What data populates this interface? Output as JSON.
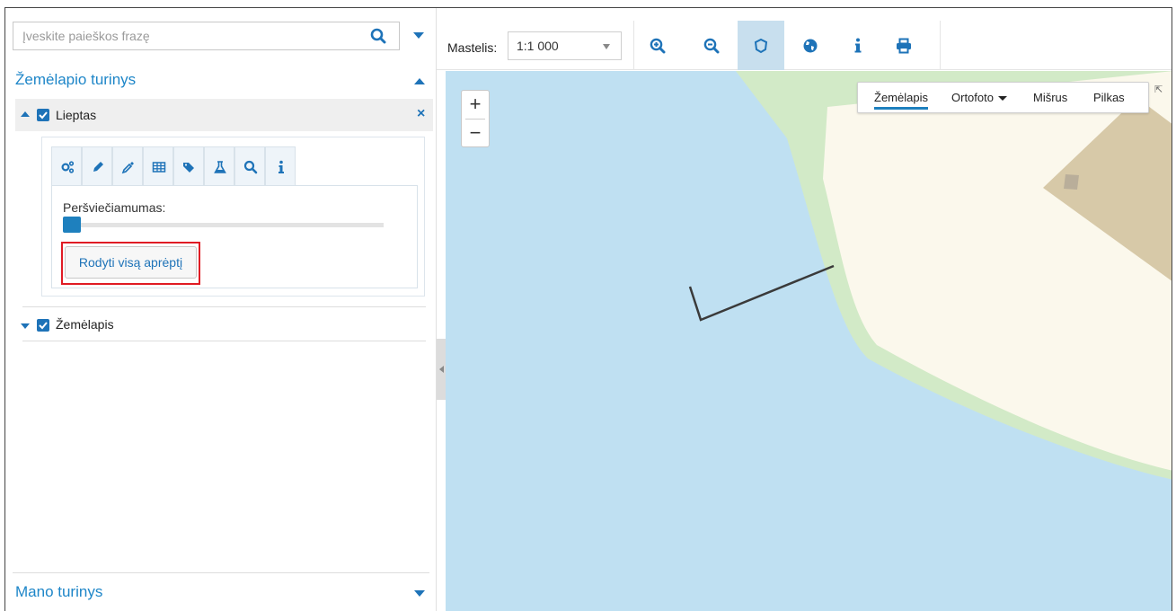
{
  "search": {
    "placeholder": "Įveskite paieškos frazę"
  },
  "sidebar": {
    "map_content_title": "Žemėlapio turinys",
    "layers": [
      {
        "label": "Lieptas",
        "checked": true,
        "expanded": true
      },
      {
        "label": "Žemėlapis",
        "checked": true,
        "expanded": false
      }
    ],
    "layer_tabs": [
      "settings-icon",
      "pencil-icon",
      "dropper-icon",
      "table-icon",
      "tags-icon",
      "flask-icon",
      "search-icon",
      "info-icon"
    ],
    "opacity_label": "Peršviečiamumas:",
    "opacity_value": 0,
    "extent_button": "Rodyti visą aprėptį",
    "my_content_title": "Mano turinys"
  },
  "toolbar": {
    "scale_label": "Mastelis:",
    "scale_value": "1:1 000",
    "buttons": [
      "zoom-in-icon",
      "zoom-out-icon",
      "polygon-select-icon",
      "globe-icon",
      "info-icon",
      "print-icon"
    ],
    "active_button": "polygon-select-icon"
  },
  "map": {
    "zoom_in": "+",
    "zoom_out": "−",
    "basemaps": [
      {
        "label": "Žemėlapis",
        "active": true
      },
      {
        "label": "Ortofoto",
        "has_dropdown": true
      },
      {
        "label": "Mišrus"
      },
      {
        "label": "Pilkas"
      }
    ],
    "colors": {
      "water": "#bfe0f2",
      "land": "#fbf8ec",
      "park": "#d2eac7",
      "building": "#d7c9a8",
      "accent": "#1e80be"
    }
  }
}
